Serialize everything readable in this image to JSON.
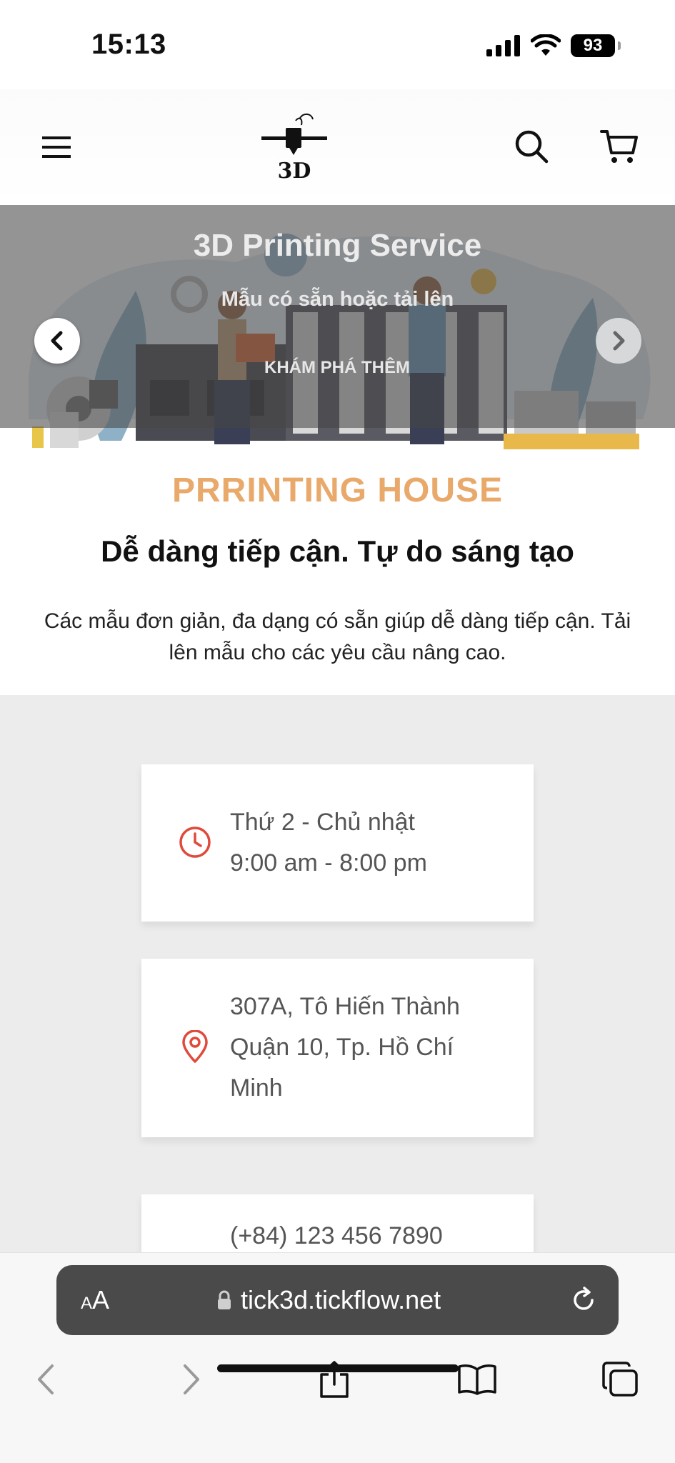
{
  "status_bar": {
    "time": "15:13",
    "battery": "93",
    "icons": [
      "cellular-signal-icon",
      "wifi-icon",
      "battery-icon"
    ]
  },
  "header": {
    "logo_text": "3D",
    "icons": {
      "menu": "hamburger-menu-icon",
      "search": "search-icon",
      "cart": "shopping-cart-icon"
    }
  },
  "hero": {
    "title": "3D Printing Service",
    "subtitle": "Mẫu có sẵn hoặc tải lên",
    "cta_label": "KHÁM PHÁ THÊM",
    "caption": "PRRINTING HOUSE",
    "prev_icon": "chevron-left-icon",
    "next_icon": "chevron-right-icon"
  },
  "intro": {
    "heading": "Dễ dàng tiếp cận. Tự do sáng tạo",
    "text": "Các mẫu đơn giản, đa dạng có sẵn giúp dễ dàng tiếp cận. Tải lên mẫu cho các yêu cầu nâng cao."
  },
  "info": {
    "hours": {
      "icon": "clock-icon",
      "line1": "Thứ 2 - Chủ nhật",
      "line2": "9:00 am - 8:00 pm"
    },
    "address": {
      "icon": "location-pin-icon",
      "line1": "307A, Tô Hiến Thành",
      "line2": "Quận 10, Tp. Hồ Chí",
      "line3": "Minh"
    },
    "phone": {
      "text": "(+84) 123 456 7890"
    }
  },
  "browser": {
    "aa_small": "A",
    "aa_large": "A",
    "url": "tick3d.tickflow.net",
    "icons": [
      "lock-icon",
      "reload-icon",
      "back-icon",
      "forward-icon",
      "share-icon",
      "bookmarks-icon",
      "tabs-icon"
    ]
  },
  "colors": {
    "accent_red": "#e04a3c",
    "caption_orange": "#e8a96b",
    "info_background": "#ececec"
  }
}
